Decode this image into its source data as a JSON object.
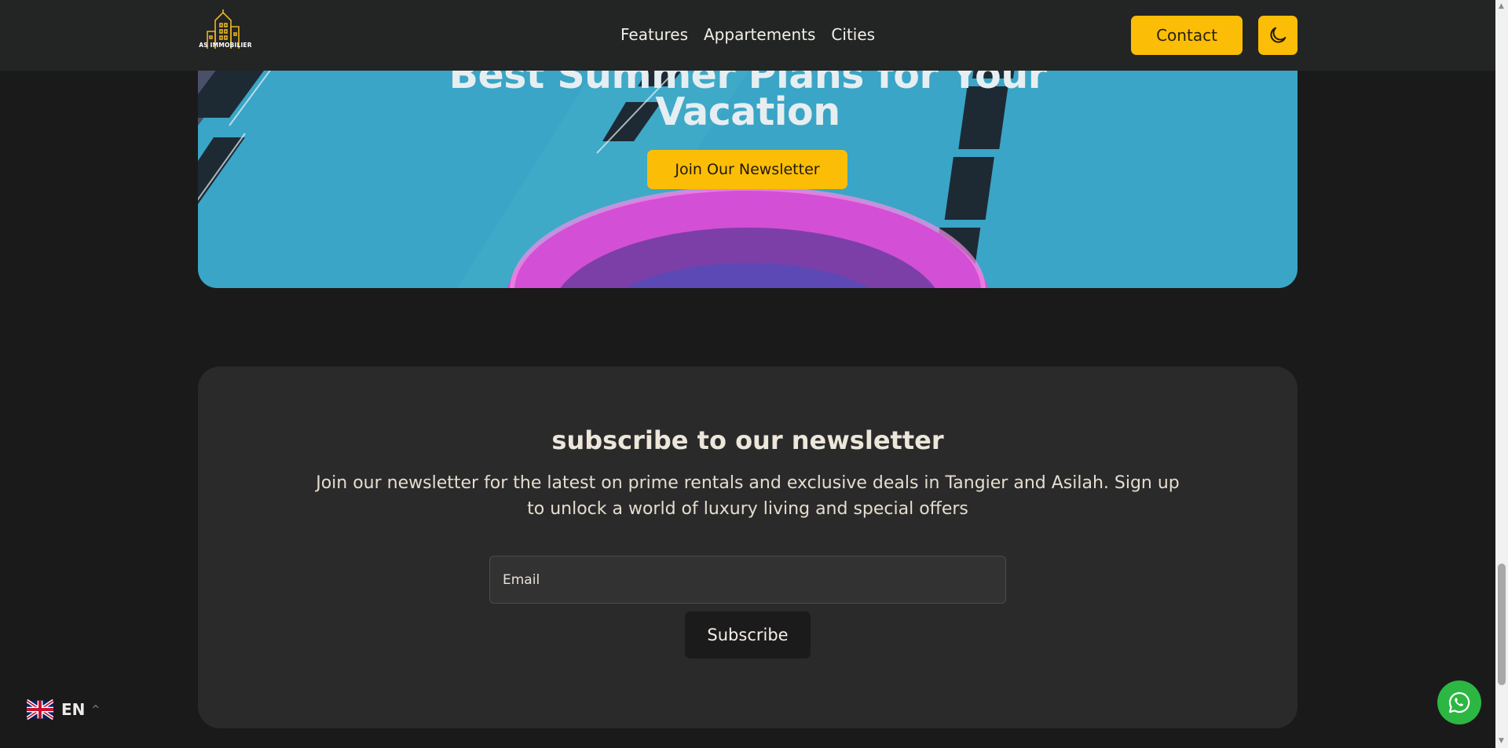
{
  "header": {
    "logo_text": "AS IMMOBILIER",
    "nav": [
      {
        "label": "Features"
      },
      {
        "label": "Appartements"
      },
      {
        "label": "Cities"
      }
    ],
    "contact_label": "Contact",
    "theme_icon": "moon-icon"
  },
  "hero": {
    "title_line1": "Best Summer Plans for Your",
    "title_line2": "Vacation",
    "button_label": "Join Our Newsletter"
  },
  "newsletter": {
    "title": "subscribe to our newsletter",
    "description": "Join our newsletter for the latest on prime rentals and exclusive deals in Tangier and Asilah. Sign up to unlock a world of luxury living and special offers",
    "email_placeholder": "Email",
    "subscribe_label": "Subscribe"
  },
  "language": {
    "code": "EN",
    "flag_icon": "uk-flag-icon"
  },
  "whatsapp": {
    "icon": "whatsapp-icon"
  },
  "colors": {
    "accent": "#fbbd06",
    "page_bg": "#1b1a1a",
    "header_bg": "#232424",
    "card_bg": "#2b2a2a",
    "whatsapp": "#2cb742"
  }
}
